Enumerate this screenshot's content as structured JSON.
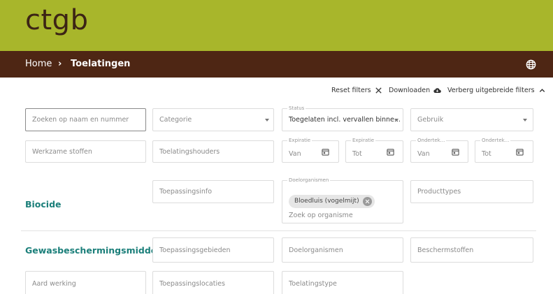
{
  "header": {
    "logo": "ctgb",
    "breadcrumb": {
      "home": "Home",
      "separator": "›",
      "current": "Toelatingen"
    }
  },
  "actions": {
    "reset": "Reset filters",
    "download": "Downloaden",
    "advanced": "Verberg uitgebreide filters"
  },
  "filters": {
    "search_placeholder": "Zoeken op naam en nummer",
    "categorie_placeholder": "Categorie",
    "status_label": "Status",
    "status_value": "Toegelaten incl. vervallen binne...",
    "gebruik_placeholder": "Gebruik",
    "werkzame_stoffen": "Werkzame stoffen",
    "toelatingshouders": "Toelatingshouders",
    "expiratie_van_label": "Expiratie",
    "expiratie_van_ph": "Van",
    "expiratie_tot_label": "Expiratie",
    "expiratie_tot_ph": "Tot",
    "ondertekening_van_label": "Ondertek...",
    "ondertekening_van_ph": "Van",
    "ondertekening_tot_label": "Ondertek...",
    "ondertekening_tot_ph": "Tot"
  },
  "biocide": {
    "label": "Biocide",
    "toepassingsinfo": "Toepassingsinfo",
    "doelorganismen_label": "Doelorganismen",
    "chip": "Bloedluis (vogelmijt)",
    "zoek_organisme": "Zoek op organisme",
    "producttypes": "Producttypes"
  },
  "gewas": {
    "label": "Gewasbeschermingsmiddel",
    "toepassingsgebieden": "Toepassingsgebieden",
    "doelorganismen": "Doelorganismen",
    "beschermstoffen": "Beschermstoffen",
    "aard_werking": "Aard werking",
    "toepassingslocaties": "Toepassingslocaties",
    "toelatingstype": "Toelatingstype"
  },
  "colors": {
    "topbar": "#a8b62b",
    "navbar": "#4e2614",
    "section_accent": "#1b7f7a"
  }
}
